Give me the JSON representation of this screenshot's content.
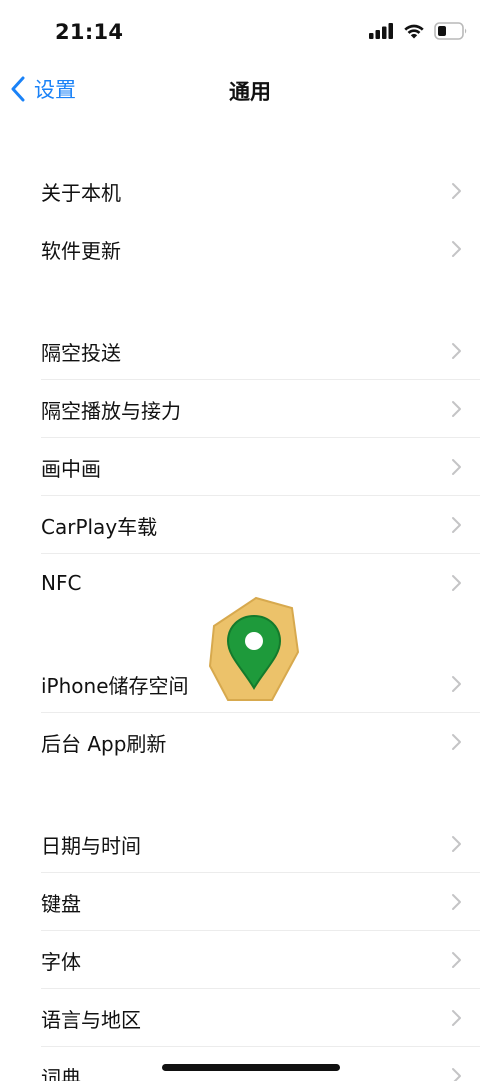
{
  "status_bar": {
    "time": "21:14",
    "icons": [
      "signal-icon",
      "wifi-icon",
      "battery-icon"
    ]
  },
  "nav": {
    "back_label": "设置",
    "title": "通用",
    "accent_color": "#1a82f7"
  },
  "groups": [
    {
      "items": [
        {
          "label": "关于本机"
        },
        {
          "label": "软件更新"
        }
      ]
    },
    {
      "items": [
        {
          "label": "隔空投送"
        },
        {
          "label": "隔空播放与接力"
        },
        {
          "label": "画中画"
        },
        {
          "label": "CarPlay车载"
        },
        {
          "label": "NFC"
        }
      ]
    },
    {
      "items": [
        {
          "label": "iPhone储存空间"
        },
        {
          "label": "后台 App刷新"
        }
      ]
    },
    {
      "items": [
        {
          "label": "日期与时间"
        },
        {
          "label": "键盘"
        },
        {
          "label": "字体"
        },
        {
          "label": "语言与地区"
        },
        {
          "label": "词典"
        }
      ]
    }
  ],
  "overlay": {
    "icon": "map-pin-icon"
  }
}
